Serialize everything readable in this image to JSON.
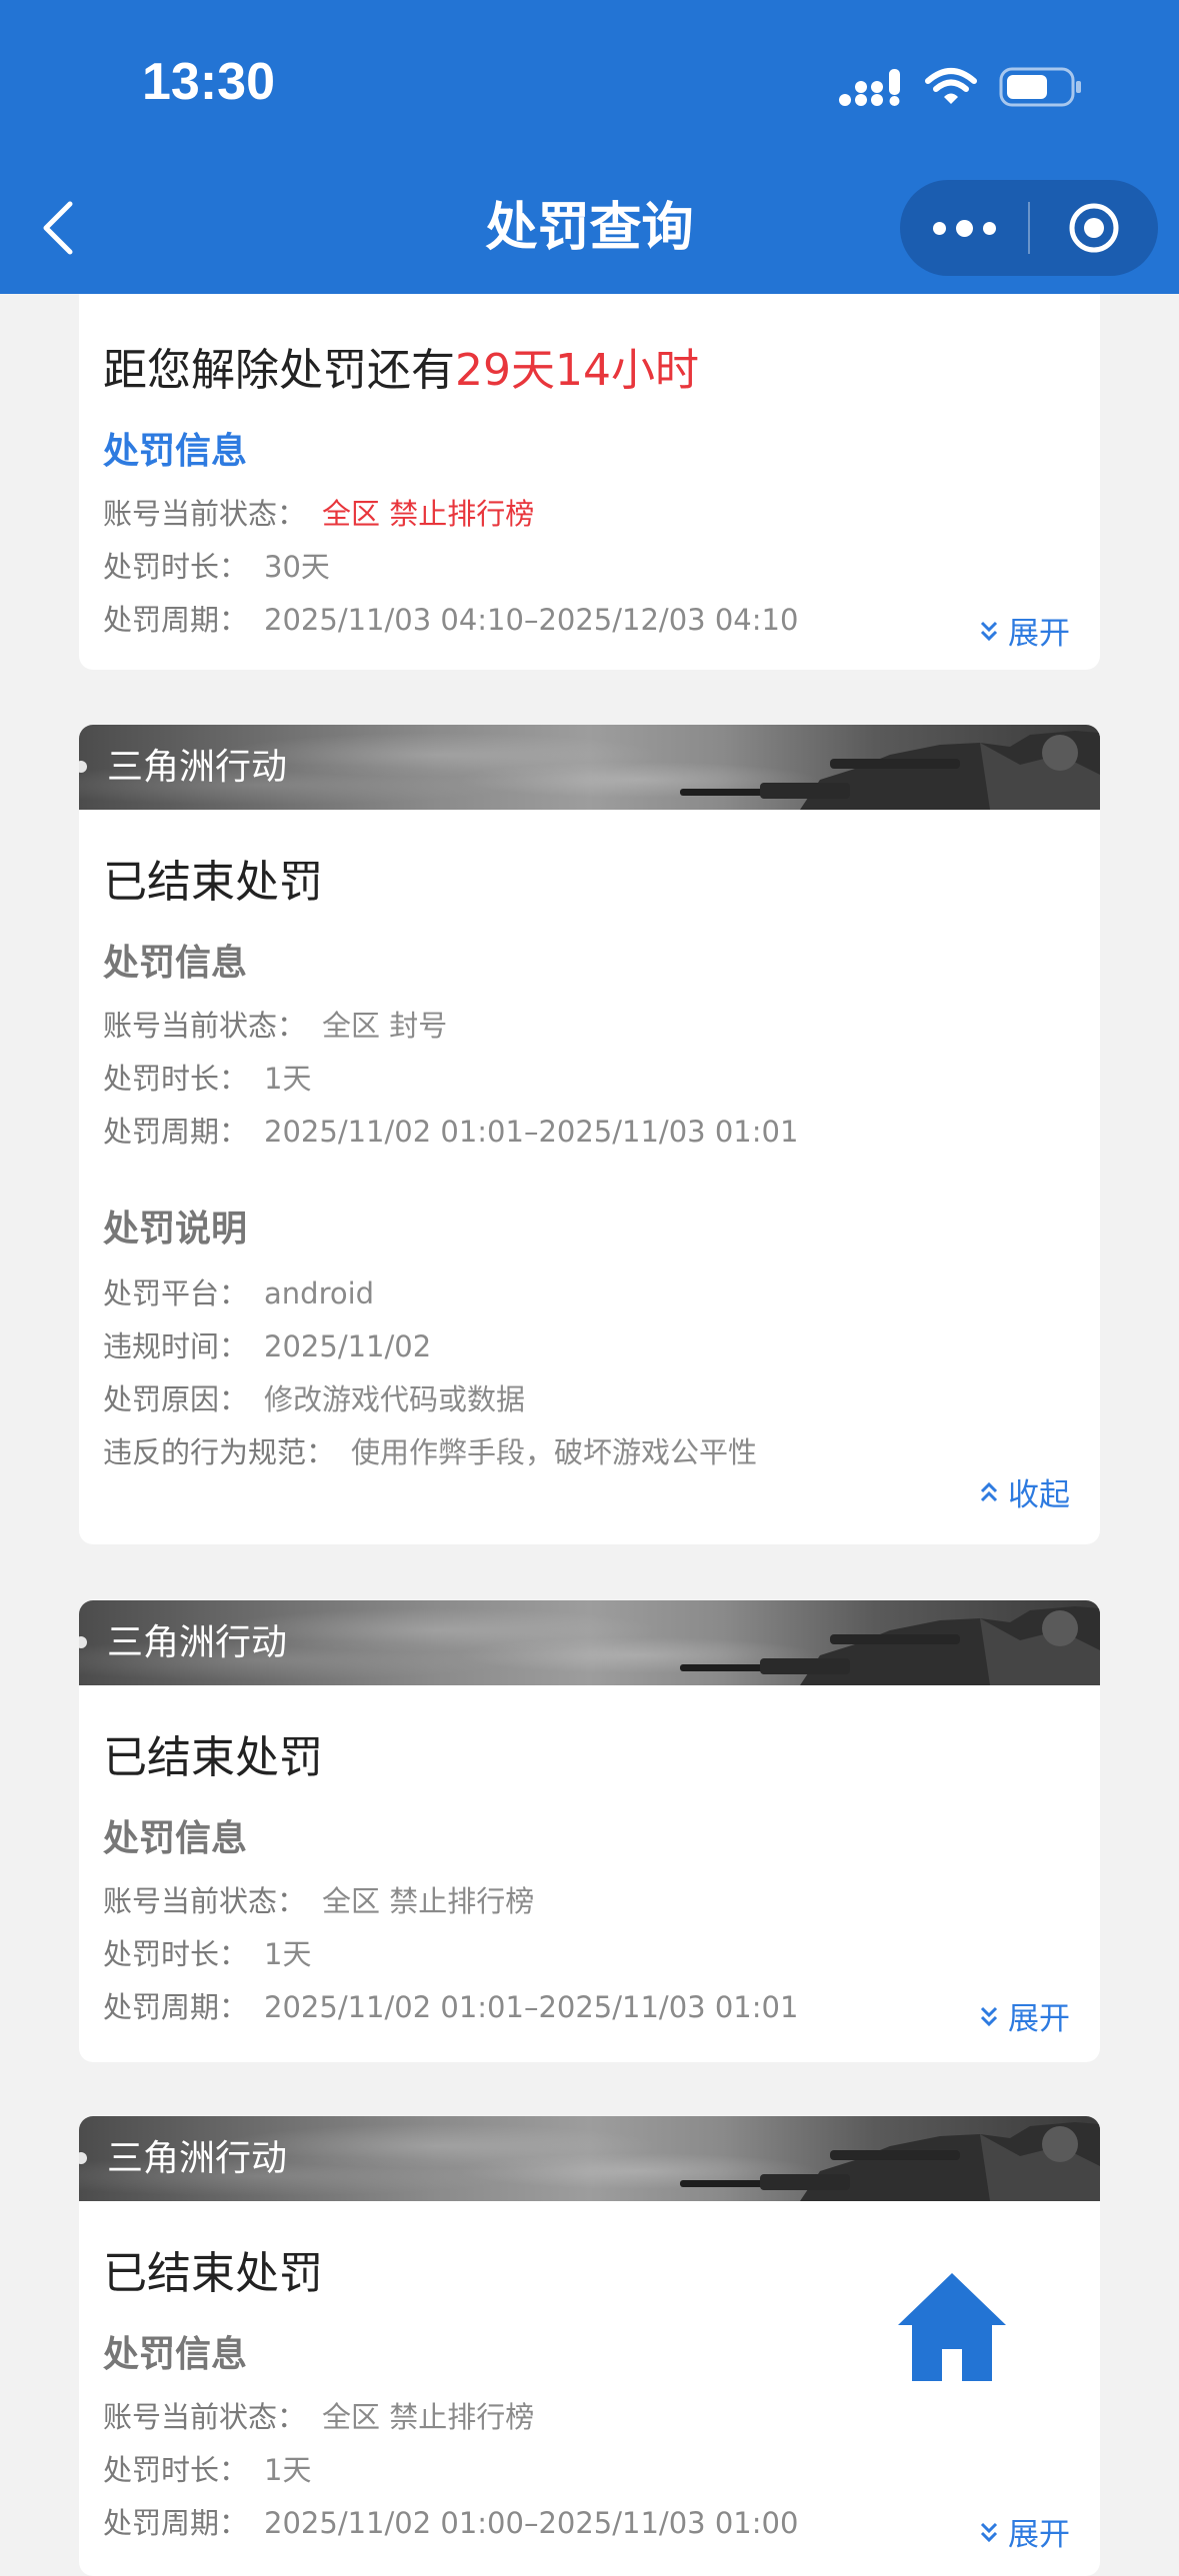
{
  "status_bar": {
    "time": "13:30"
  },
  "nav": {
    "title": "处罚查询"
  },
  "cards": [
    {
      "status_prefix": "距您解除处罚还有",
      "status_highlight": "29天14小时",
      "info_title": "处罚信息",
      "rows": [
        {
          "label": "账号当前状态：",
          "value": "全区 禁止排行榜"
        },
        {
          "label": "处罚时长：",
          "value": "30天"
        },
        {
          "label": "处罚周期：",
          "value": "2025/11/03 04:10–2025/12/03 04:10"
        }
      ],
      "toggle": "展开"
    },
    {
      "game": "三角洲行动",
      "status": "已结束处罚",
      "info_title": "处罚信息",
      "rows": [
        {
          "label": "账号当前状态：",
          "value": "全区 封号"
        },
        {
          "label": "处罚时长：",
          "value": "1天"
        },
        {
          "label": "处罚周期：",
          "value": "2025/11/02 01:01–2025/11/03 01:01"
        }
      ],
      "desc_title": "处罚说明",
      "desc_rows": [
        {
          "label": "处罚平台：",
          "value": "android"
        },
        {
          "label": "违规时间：",
          "value": "2025/11/02"
        },
        {
          "label": "处罚原因：",
          "value": "修改游戏代码或数据"
        },
        {
          "label": "违反的行为规范：",
          "value": "使用作弊手段，破坏游戏公平性"
        }
      ],
      "toggle": "收起"
    },
    {
      "game": "三角洲行动",
      "status": "已结束处罚",
      "info_title": "处罚信息",
      "rows": [
        {
          "label": "账号当前状态：",
          "value": "全区 禁止排行榜"
        },
        {
          "label": "处罚时长：",
          "value": "1天"
        },
        {
          "label": "处罚周期：",
          "value": "2025/11/02 01:01–2025/11/03 01:01"
        }
      ],
      "toggle": "展开"
    },
    {
      "game": "三角洲行动",
      "status": "已结束处罚",
      "info_title": "处罚信息",
      "rows": [
        {
          "label": "账号当前状态：",
          "value": "全区 禁止排行榜"
        },
        {
          "label": "处罚时长：",
          "value": "1天"
        },
        {
          "label": "处罚周期：",
          "value": "2025/11/02 01:00–2025/11/03 01:00"
        }
      ],
      "toggle": "展开"
    }
  ],
  "colors": {
    "header": "#2374d4",
    "accent": "#2e7be0",
    "alert": "#e8363c"
  }
}
